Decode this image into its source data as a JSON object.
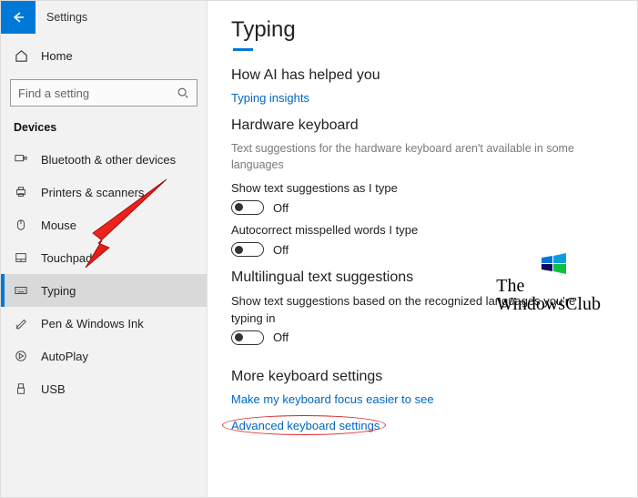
{
  "topbar": {
    "settings_label": "Settings"
  },
  "sidebar": {
    "home_label": "Home",
    "search_placeholder": "Find a setting",
    "section_label": "Devices",
    "items": [
      {
        "label": "Bluetooth & other devices"
      },
      {
        "label": "Printers & scanners"
      },
      {
        "label": "Mouse"
      },
      {
        "label": "Touchpad"
      },
      {
        "label": "Typing"
      },
      {
        "label": "Pen & Windows Ink"
      },
      {
        "label": "AutoPlay"
      },
      {
        "label": "USB"
      }
    ]
  },
  "page": {
    "title": "Typing",
    "sec1": {
      "heading": "How AI has helped you",
      "link": "Typing insights"
    },
    "sec2": {
      "heading": "Hardware keyboard",
      "desc": "Text suggestions for the hardware keyboard aren't available in some languages",
      "opt1_label": "Show text suggestions as I type",
      "opt1_state": "Off",
      "opt2_label": "Autocorrect misspelled words I type",
      "opt2_state": "Off"
    },
    "sec3": {
      "heading": "Multilingual text suggestions",
      "opt1_label": "Show text suggestions based on the recognized languages you're typing in",
      "opt1_state": "Off"
    },
    "sec4": {
      "heading": "More keyboard settings",
      "link1": "Make my keyboard focus easier to see",
      "link2": "Advanced keyboard settings"
    }
  },
  "watermark": {
    "line1": "The",
    "line2": "WindowsClub"
  }
}
